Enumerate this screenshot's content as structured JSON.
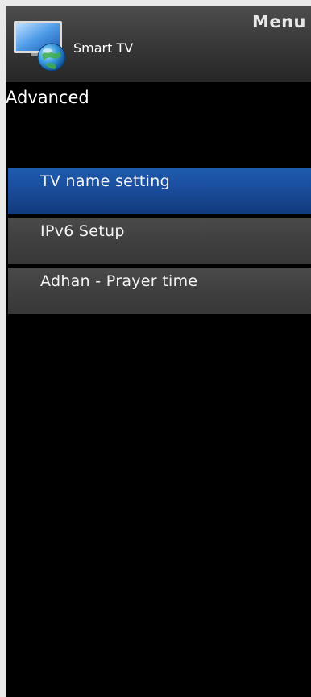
{
  "header": {
    "menu_title": "Menu",
    "section_label": "Smart TV",
    "icon": "smart-tv-globe-icon"
  },
  "page": {
    "title": "Advanced"
  },
  "menu": {
    "selected_index": 0,
    "items": [
      {
        "label": "TV name setting"
      },
      {
        "label": "IPv6 Setup"
      },
      {
        "label": "Adhan - Prayer time"
      }
    ]
  },
  "colors": {
    "background": "#000000",
    "selected": "#1b4fa0",
    "item": "#3f3f3f",
    "frame": "#e9e9e9"
  }
}
